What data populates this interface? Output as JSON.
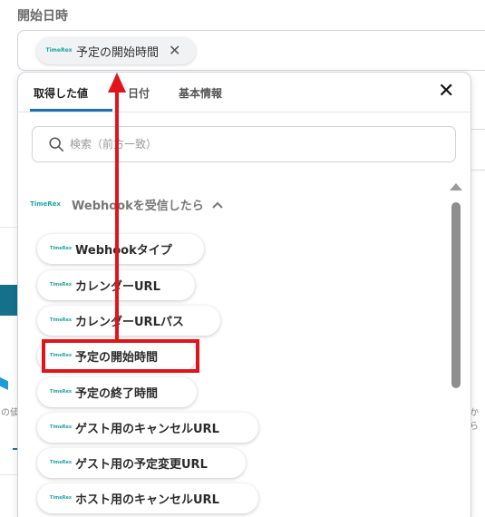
{
  "background": {
    "field_label": "開始日時",
    "selected_chip": {
      "label": "予定の開始時間",
      "logo": "TimeRex"
    },
    "left_text": "の値",
    "right_text": "から"
  },
  "popup": {
    "tabs": [
      {
        "label": "取得した値",
        "active": true
      },
      {
        "label": "日付",
        "active": false
      },
      {
        "label": "基本情報",
        "active": false
      }
    ],
    "search_placeholder": "検索（前方一致）",
    "section": {
      "logo": "TimeRex",
      "title": "Webhookを受信したら"
    },
    "items": [
      {
        "label": "Webhookタイプ",
        "logo": "TimeRex"
      },
      {
        "label": "カレンダーURL",
        "logo": "TimeRex"
      },
      {
        "label": "カレンダーURLパス",
        "logo": "TimeRex"
      },
      {
        "label": "予定の開始時間",
        "logo": "TimeRex",
        "highlighted": true
      },
      {
        "label": "予定の終了時間",
        "logo": "TimeRex"
      },
      {
        "label": "ゲスト用のキャンセルURL",
        "logo": "TimeRex"
      },
      {
        "label": "ゲスト用の予定変更URL",
        "logo": "TimeRex"
      },
      {
        "label": "ホスト用のキャンセルURL",
        "logo": "TimeRex"
      }
    ]
  },
  "colors": {
    "accent": "#1a6fb0",
    "highlight": "#e0151b",
    "logo": "#1fa3a3"
  }
}
